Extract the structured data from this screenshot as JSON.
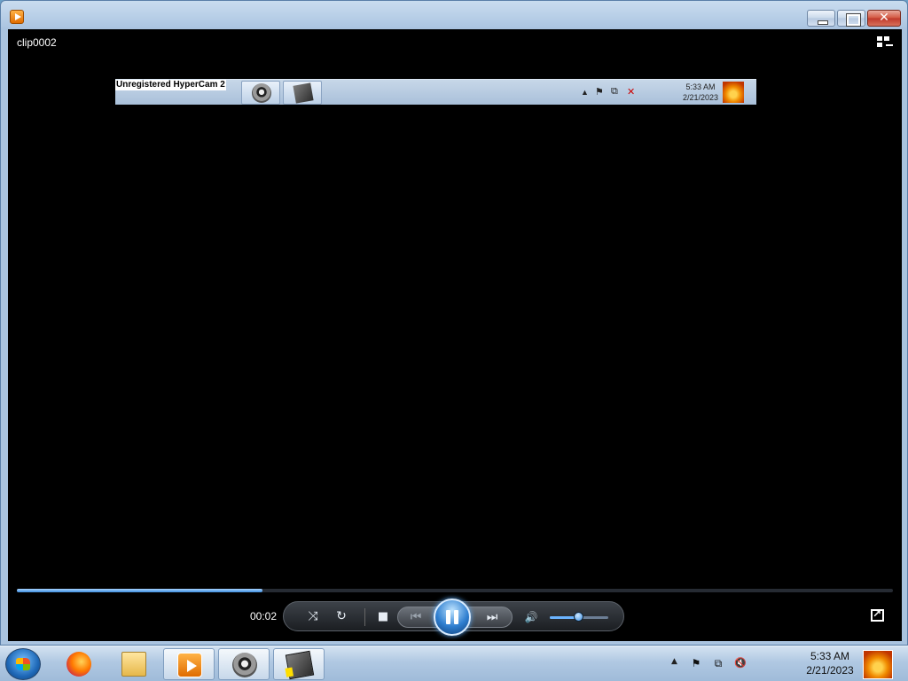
{
  "window": {
    "title_icon": "media-player-icon",
    "controls": {
      "minimize": "minimize",
      "maximize": "maximize",
      "close": "✕"
    }
  },
  "player": {
    "clip_title": "clip0002",
    "elapsed_time": "00:02",
    "seek_progress": 0.28,
    "volume_level": 0.5,
    "icons": [
      "shuffle-icon",
      "repeat-icon",
      "stop-icon",
      "previous-icon",
      "pause-icon",
      "next-icon",
      "volume-icon",
      "fullscreen-icon",
      "switch-to-library-icon"
    ],
    "labels": {
      "shuffle": "⤨",
      "repeat": "↻",
      "stop": "■",
      "previous": "⏮",
      "next": "⏭",
      "volume": "🔊"
    }
  },
  "video": {
    "watermark": "Unregistered HyperCam 2",
    "time": "5:33 AM",
    "date": "2/21/2023"
  },
  "taskbar": {
    "apps": [
      "firefox",
      "file-explorer",
      "windows-media-player",
      "raccoon-app",
      "hypercam"
    ],
    "tray": {
      "show_hidden": "▲",
      "flag": "⚑",
      "network": "⧉",
      "volume_muted": "🔇"
    },
    "time": "5:33 AM",
    "date": "2/21/2023"
  },
  "colors": {
    "accent": "#3c8ee0",
    "player_bg": "#000000",
    "taskbar": "#b0c8e2"
  }
}
